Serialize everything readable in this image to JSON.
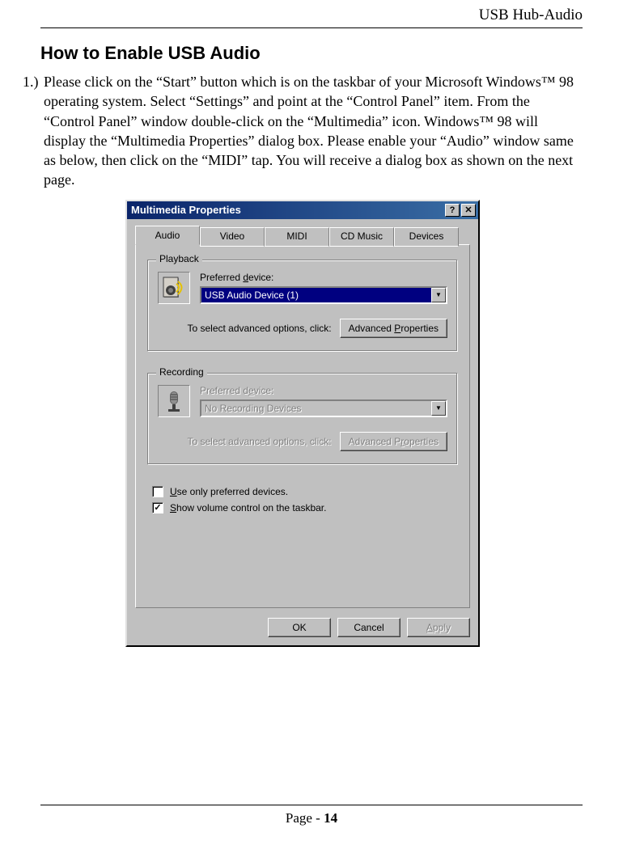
{
  "page": {
    "header": "USB Hub-Audio",
    "section_title": "How to Enable USB Audio",
    "step1_num": "1.)",
    "step1_text": "Please click on the “Start” button which is on the taskbar of your Microsoft Windows™ 98 operating system. Select “Settings” and point at the “Control Panel” item. From the “Control Panel” window double-click on the “Multimedia” icon. Windows™ 98 will display the “Multimedia Properties” dialog box. Please enable your “Audio” window same as below, then click on the “MIDI” tap. You will receive a dialog box as shown on the next page.",
    "footer_prefix": "Page - ",
    "footer_num": "14"
  },
  "dialog": {
    "title": "Multimedia Properties",
    "help": "?",
    "close": "✕",
    "tabs": {
      "audio": "Audio",
      "video": "Video",
      "midi": "MIDI",
      "cdmusic": "CD Music",
      "devices": "Devices"
    },
    "playback": {
      "legend": "Playback",
      "label_prefix": "Preferred ",
      "label_u": "d",
      "label_suffix": "evice:",
      "device": "USB Audio Device (1)",
      "adv_text": "To select advanced options, click:",
      "adv_btn_prefix": "Advanced ",
      "adv_btn_u": "P",
      "adv_btn_suffix": "roperties"
    },
    "recording": {
      "legend": "Recording",
      "label_prefix": "Preferred d",
      "label_u": "e",
      "label_suffix": "vice:",
      "device": "No Recording Devices",
      "adv_text": "To select advanced options, click:",
      "adv_btn_prefix": "Advanced P",
      "adv_btn_u": "r",
      "adv_btn_suffix": "operties"
    },
    "check1_u": "U",
    "check1_suffix": "se only preferred devices.",
    "check2_u": "S",
    "check2_suffix": "how volume control on the taskbar.",
    "ok": "OK",
    "cancel": "Cancel",
    "apply_u": "A",
    "apply_suffix": "pply"
  }
}
